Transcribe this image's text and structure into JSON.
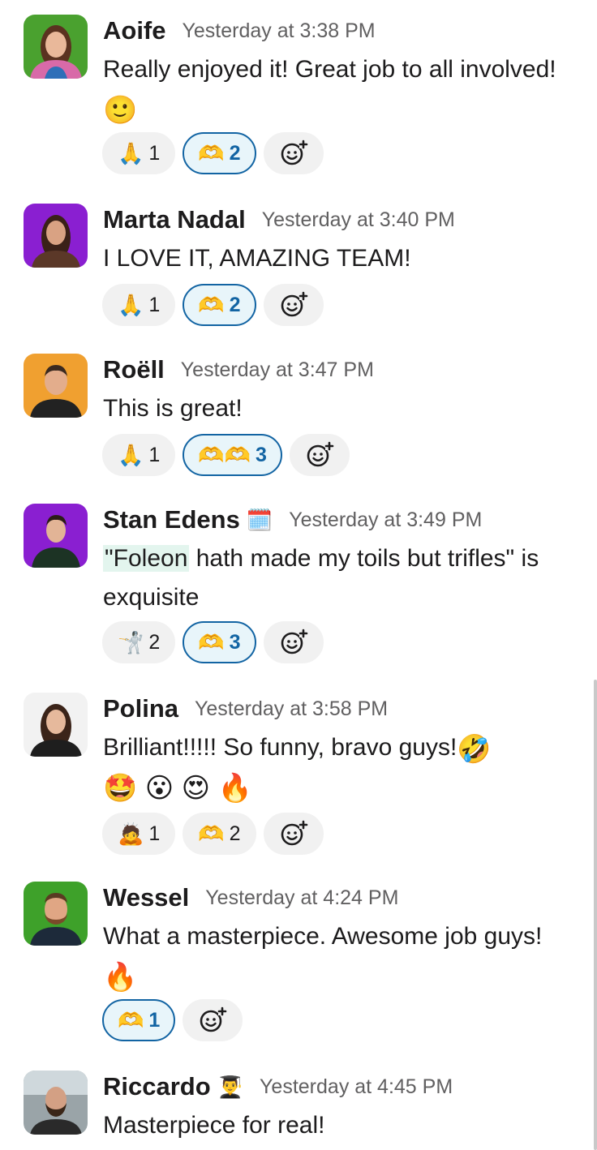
{
  "messages": [
    {
      "name": "Aoife",
      "time": "Yesterday at 3:38 PM",
      "text": "Really enjoyed it! Great job to all involved!",
      "trailing_emoji": "🙂",
      "reactions": [
        {
          "emoji": "🙏",
          "count": "1",
          "mine": false
        },
        {
          "emoji": "🫶",
          "count": "2",
          "mine": true
        }
      ]
    },
    {
      "name": "Marta Nadal",
      "time": "Yesterday at 3:40 PM",
      "text": "I LOVE IT, AMAZING TEAM!",
      "reactions": [
        {
          "emoji": "🙏",
          "count": "1",
          "mine": false
        },
        {
          "emoji": "🫶",
          "count": "2",
          "mine": true
        }
      ]
    },
    {
      "name": "Roëll",
      "time": "Yesterday at 3:47 PM",
      "text": "This is great!",
      "reactions": [
        {
          "emoji": "🙏",
          "count": "1",
          "mine": false
        },
        {
          "emoji": "🫶🫶",
          "count": "3",
          "mine": true
        }
      ]
    },
    {
      "name": "Stan Edens",
      "status_emoji": "🗓️",
      "time": "Yesterday at 3:49 PM",
      "text_highlight": "\"Foleon",
      "text_rest": " hath made my toils but trifles\" is exquisite",
      "reactions": [
        {
          "emoji": "🤺",
          "count": "2",
          "mine": false
        },
        {
          "emoji": "🫶",
          "count": "3",
          "mine": true
        }
      ]
    },
    {
      "name": "Polina",
      "time": "Yesterday at 3:58 PM",
      "text": "Brilliant!!!!! So funny, bravo guys!",
      "trailing_emoji": "🤣",
      "emoji_line": "🤩 😮 😍 🔥",
      "reactions": [
        {
          "emoji": "🙇",
          "count": "1",
          "mine": false
        },
        {
          "emoji": "🫶",
          "count": "2",
          "mine": false
        }
      ]
    },
    {
      "name": "Wessel",
      "time": "Yesterday at 4:24 PM",
      "text": "What a masterpiece. Awesome job guys!",
      "trailing_emoji": "🔥",
      "reactions": [
        {
          "emoji": "🫶",
          "count": "1",
          "mine": true
        }
      ]
    },
    {
      "name": "Riccardo",
      "status_emoji": "👨‍🎓",
      "time": "Yesterday at 4:45 PM",
      "text": "Masterpiece for real!"
    }
  ],
  "add_reaction_icon": "add-emoji-icon",
  "colors": {
    "accent": "#1264a3",
    "pill_bg": "#f1f1f1",
    "mine_bg": "#e8f5fa",
    "highlight_bg": "#e3f5ee",
    "timestamp": "#616061"
  }
}
